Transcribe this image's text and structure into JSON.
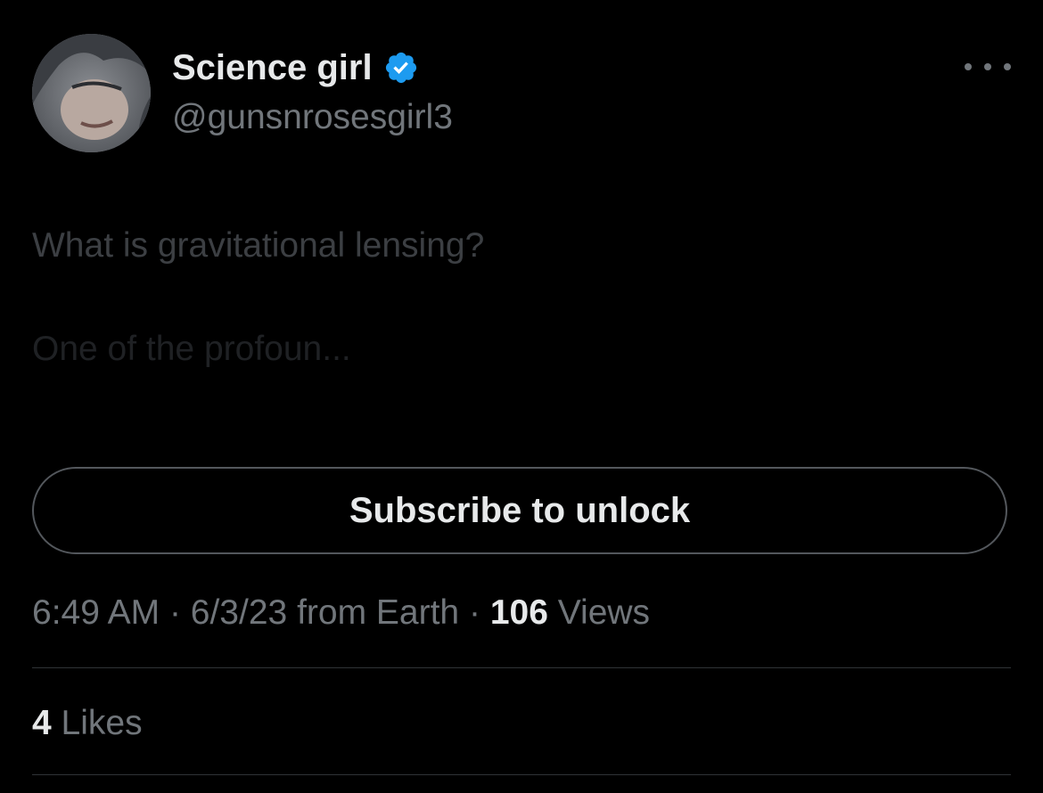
{
  "author": {
    "name": "Science girl",
    "handle": "@gunsnrosesgirl3",
    "verified": true,
    "verified_color": "#1d9bf0"
  },
  "tweet": {
    "text": "What is gravitational lensing?",
    "teaser": "One of the profoun..."
  },
  "subscribe_button": {
    "label": "Subscribe to unlock"
  },
  "meta": {
    "time": "6:49 AM",
    "separator": "·",
    "date": "6/3/23",
    "from_prefix": "from",
    "location": "Earth",
    "views_count": "106",
    "views_label": "Views"
  },
  "engagement": {
    "likes_count": "4",
    "likes_label": "Likes"
  },
  "icons": {
    "more": "more-horizontal-icon",
    "verified": "verified-badge-icon"
  },
  "colors": {
    "background": "#000000",
    "primary_text": "#e7e9ea",
    "secondary_text": "#71767b",
    "divider": "#2f3336"
  }
}
